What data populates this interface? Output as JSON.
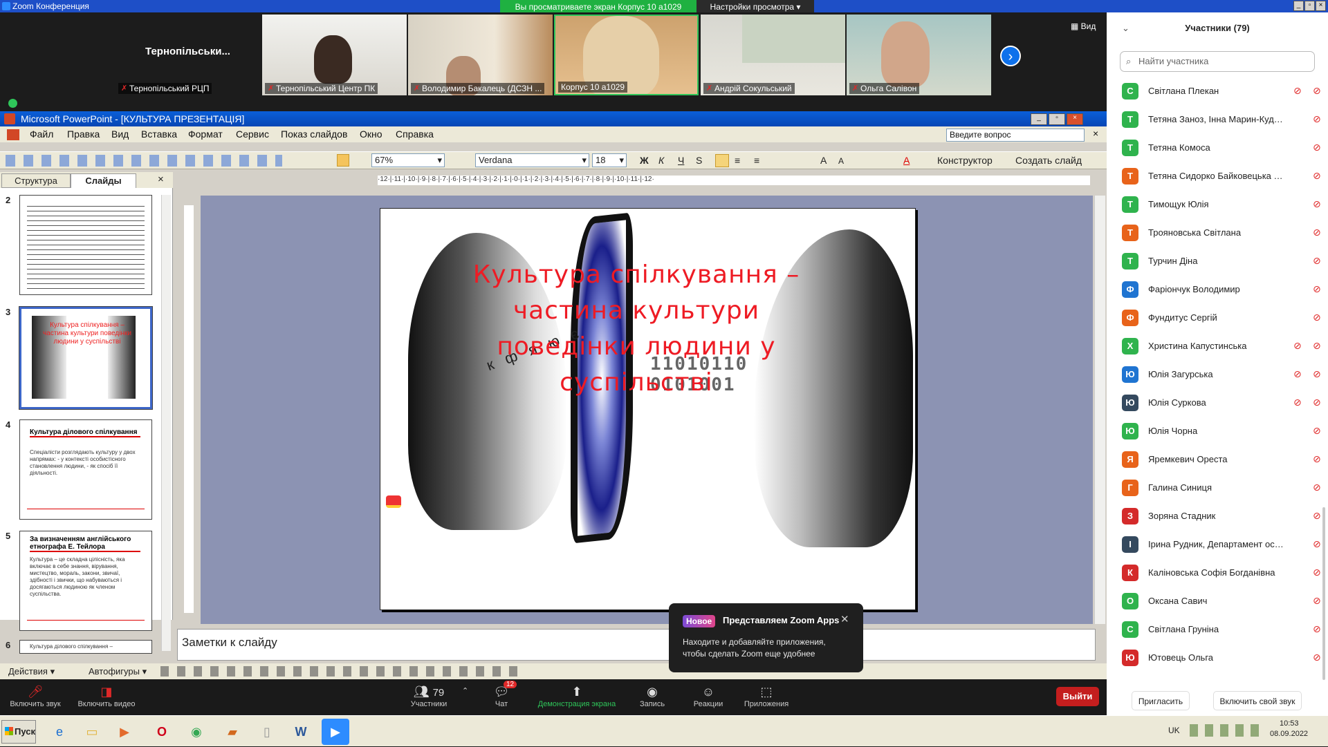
{
  "zoom": {
    "window_title": "Zoom Конференция",
    "share_banner": "Вы просматриваете экран Корпус 10 а1029",
    "view_options": "Настройки просмотра",
    "view_button": "Вид"
  },
  "video_tiles": [
    {
      "name": "Тернопільський РЦП",
      "big_label": "Тернопільськи..."
    },
    {
      "name": "Тернопільський Центр ПК",
      "big_label": ""
    },
    {
      "name": "Володимир Бакалець (ДСЗН ...",
      "big_label": ""
    },
    {
      "name": "Корпус 10 а1029",
      "big_label": ""
    },
    {
      "name": "Андрій Сокульський",
      "big_label": ""
    },
    {
      "name": "Ольга Салівон",
      "big_label": ""
    }
  ],
  "participants": {
    "title": "Участники (79)",
    "search_placeholder": "Найти участника",
    "list": [
      {
        "initial": "С",
        "name": "Світлана Плекан",
        "color": "#2fb34d",
        "cam_off": true
      },
      {
        "initial": "Т",
        "name": "Тетяна Заноз, Інна Марин-Кудря...",
        "color": "#2fb34d",
        "cam_off": false
      },
      {
        "initial": "Т",
        "name": "Тетяна Комоса",
        "color": "#2fb34d",
        "cam_off": false
      },
      {
        "initial": "Т",
        "name": "Тетяна Сидорко Байковецька сіль...",
        "color": "#e8631a",
        "cam_off": false
      },
      {
        "initial": "Т",
        "name": "Тимощук Юлія",
        "color": "#2fb34d",
        "cam_off": false
      },
      {
        "initial": "Т",
        "name": "Трояновська Світлана",
        "color": "#e8631a",
        "cam_off": false
      },
      {
        "initial": "Т",
        "name": "Турчин Діна",
        "color": "#2fb34d",
        "cam_off": false
      },
      {
        "initial": "Ф",
        "name": "Фаріончук Володимир",
        "color": "#1f74d1",
        "cam_off": false
      },
      {
        "initial": "Ф",
        "name": "Фундитус Сергій",
        "color": "#e8631a",
        "cam_off": false
      },
      {
        "initial": "Х",
        "name": "Христина Капустинська",
        "color": "#2fb34d",
        "cam_off": true
      },
      {
        "initial": "Ю",
        "name": "Юлія Загурська",
        "color": "#1f74d1",
        "cam_off": true
      },
      {
        "initial": "Ю",
        "name": "Юлія Суркова",
        "color": "#34495e",
        "cam_off": true
      },
      {
        "initial": "Ю",
        "name": "Юлія Чорна",
        "color": "#2fb34d",
        "cam_off": false
      },
      {
        "initial": "Я",
        "name": "Яремкевич Ореста",
        "color": "#e8631a",
        "cam_off": false
      },
      {
        "initial": "Г",
        "name": "Галина Синиця",
        "color": "#e8631a",
        "cam_off": false
      },
      {
        "initial": "З",
        "name": "Зоряна Стадник",
        "color": "#d42a2a",
        "cam_off": false
      },
      {
        "initial": "І",
        "name": "Ірина Рудник, Департамент освіти і на...",
        "color": "#34495e",
        "cam_off": false
      },
      {
        "initial": "К",
        "name": "Каліновська Софія Богданівна",
        "color": "#d42a2a",
        "cam_off": false
      },
      {
        "initial": "О",
        "name": "Оксана Савич",
        "color": "#2fb34d",
        "cam_off": false
      },
      {
        "initial": "С",
        "name": "Світлана Груніна",
        "color": "#2fb34d",
        "cam_off": false
      },
      {
        "initial": "Ю",
        "name": "Ютовець Ольга",
        "color": "#d42a2a",
        "cam_off": false
      }
    ],
    "invite_label": "Пригласить",
    "unmute_self_label": "Включить свой звук"
  },
  "powerpoint": {
    "title": "Microsoft PowerPoint - [КУЛЬТУРА ПРЕЗЕНТАЦІЯ]",
    "menu": [
      "Файл",
      "Правка",
      "Вид",
      "Вставка",
      "Формат",
      "Сервис",
      "Показ слайдов",
      "Окно",
      "Справка"
    ],
    "ask_placeholder": "Введите вопрос",
    "zoom_level": "67%",
    "font_name": "Verdana",
    "font_size": "18",
    "designer_label": "Конструктор",
    "new_slide_label": "Создать слайд",
    "tab_outline": "Структура",
    "tab_slides": "Слайды",
    "thumbs": [
      {
        "num": "2",
        "title": ""
      },
      {
        "num": "3",
        "title": "Культура спілкування – частина культури поведінки людини у суспільстві"
      },
      {
        "num": "4",
        "title": "Культура ділового спілкування",
        "text": "Спеціалісти розглядають культуру у двох напрямах: - у контексті особистісного становлення людини, - як спосіб її діяльності."
      },
      {
        "num": "5",
        "title": "За визначенням англійського етнографа Е. Тейлора",
        "text": "Культура – це складна цілісність, яка включає в себе знання, вірування, мистецтво, мораль, закони, звичаї, здібності і звички, що набуваються і досягаються людиною як членом суспільства."
      },
      {
        "num": "6",
        "title": "Культура ділового спілкування –"
      }
    ],
    "slide_title": "Культура спілкування – частина культури поведінки людини у суспільстві",
    "notes_placeholder": "Заметки к слайду",
    "draw_actions": "Действия",
    "autoshapes": "Автофигуры",
    "ruler_text": "·12·|·11·|·10·|·9·|·8·|·7·|·6·|·5·|·4·|·3·|·2·|·1·|·0·|·1·|·2·|·3·|·4·|·5·|·6·|·7·|·8·|·9·|·10·|·11·|·12·"
  },
  "popup": {
    "badge": "Новое",
    "title": "Представляем Zoom Apps",
    "body": "Находите и добавляйте приложения, чтобы сделать Zoom еще удобнее"
  },
  "controls": {
    "mute": "Включить звук",
    "video": "Включить видео",
    "participants": "Участники",
    "participants_count": "79",
    "chat": "Чат",
    "chat_badge": "12",
    "share": "Демонстрация экрана",
    "record": "Запись",
    "reactions": "Реакции",
    "apps": "Приложения",
    "leave": "Выйти"
  },
  "taskbar": {
    "start": "Пуск",
    "lang": "UK",
    "time": "10:53",
    "date": "08.09.2022"
  }
}
